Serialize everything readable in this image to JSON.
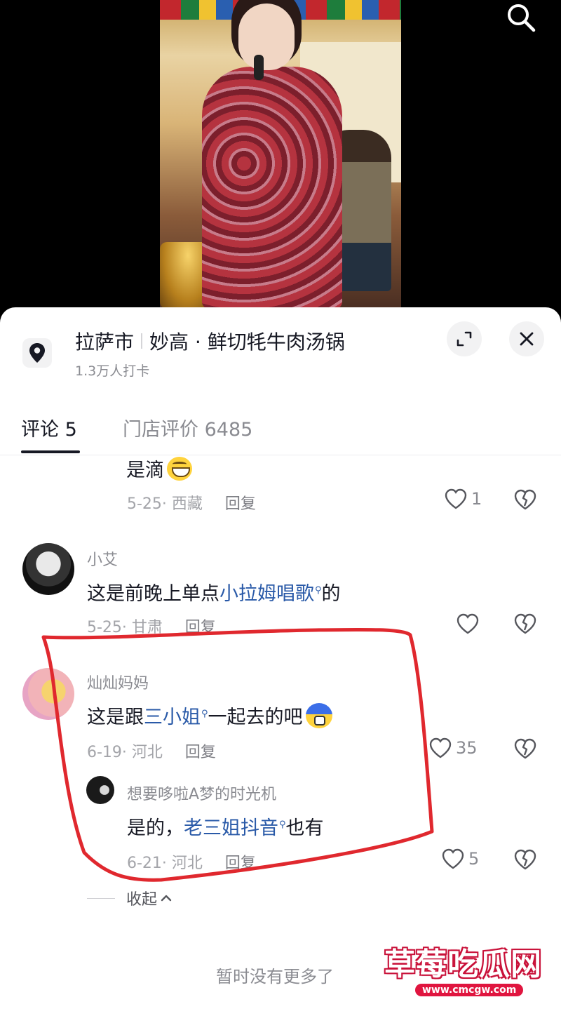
{
  "location": {
    "city": "拉萨市",
    "name": "妙高 · 鲜切牦牛肉汤锅",
    "checkins": "1.3万人打卡"
  },
  "tabs": {
    "comments": "评论 5",
    "reviews": "门店评价 6485"
  },
  "comments": [
    {
      "text": "是滴",
      "emoji": "grin-emoji",
      "date_region": "5-25· 西藏",
      "reply": "回复",
      "likes": "1"
    },
    {
      "user": "小艾",
      "text_before": "这是前晚上单点",
      "keyword": "小拉姆唱歌",
      "text_after": "的",
      "date_region": "5-25· 甘肃",
      "reply": "回复"
    },
    {
      "user": "灿灿妈妈",
      "text_before": "这是跟",
      "keyword": "三小姐",
      "text_after": "一起去的吧",
      "emoji": "cold-sweat-emoji",
      "date_region": "6-19· 河北",
      "reply": "回复",
      "likes": "35"
    },
    {
      "user": "想要哆啦A梦的时光机",
      "text_before": "是的，",
      "keyword": "老三姐抖音",
      "text_after": "也有",
      "date_region": "6-21· 河北",
      "reply": "回复",
      "likes": "5"
    }
  ],
  "collapse_label": "收起",
  "no_more": "暂时没有更多了",
  "watermark": {
    "logo": "草莓吃瓜网",
    "url": "www.cmcgw.com"
  },
  "colors": {
    "keyword": "#2a5aa8",
    "annotation": "#e0282e"
  },
  "icons": [
    "search-icon",
    "location-pin-icon",
    "expand-icon",
    "close-icon",
    "heart-icon",
    "broken-heart-icon",
    "chevron-up-icon"
  ]
}
